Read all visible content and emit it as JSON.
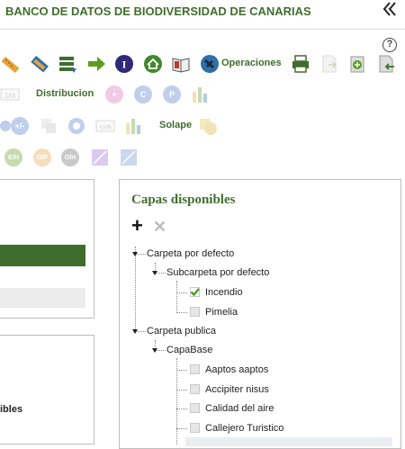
{
  "header": {
    "title": "BANCO DE DATOS DE BIODIVERSIDAD DE CANARIAS",
    "collapse_icon": "double-chevron-left-icon",
    "help_glyph": "?"
  },
  "toolbar": {
    "operaciones_label": "Operaciones",
    "distribucion_label": "Distribucion",
    "solape_label": "Solape",
    "row2_badges": [
      "123",
      "+",
      "C",
      "P"
    ],
    "row3_badges": [
      "+/-",
      "",
      "<x%"
    ],
    "row4_badges": [
      "E/H",
      "O/P",
      "O/H"
    ],
    "colors": {
      "green": "#3f6e2c",
      "orange": "#e8a33d",
      "blue": "#2f6fa7",
      "navy": "#2d2a7a",
      "arrow_green": "#5a9e1f"
    }
  },
  "left_panel": {
    "partial_label": "ibles"
  },
  "capas": {
    "title": "Capas disponibles",
    "add_icon": "plus-icon",
    "remove_icon": "close-icon",
    "tree": [
      {
        "label": "Carpeta por defecto",
        "type": "folder"
      },
      {
        "label": "Subcarpeta por defecto",
        "type": "folder"
      },
      {
        "label": "Incendio",
        "type": "layer",
        "checked": true
      },
      {
        "label": "Pimelia",
        "type": "layer",
        "checked": false
      },
      {
        "label": "Carpeta publica",
        "type": "folder"
      },
      {
        "label": "CapaBase",
        "type": "folder"
      },
      {
        "label": "Aaptos aaptos",
        "type": "layer",
        "checked": false
      },
      {
        "label": "Accipiter nisus",
        "type": "layer",
        "checked": false
      },
      {
        "label": "Calidad del aire",
        "type": "layer",
        "checked": false
      },
      {
        "label": "Callejero Turistico",
        "type": "layer",
        "checked": false
      }
    ]
  }
}
